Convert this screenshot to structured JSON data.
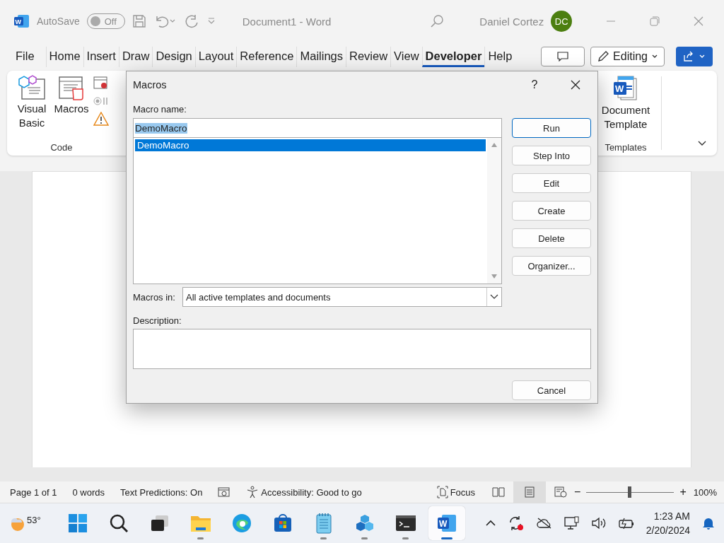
{
  "title_bar": {
    "app_logo": "W",
    "autosave_label": "AutoSave",
    "autosave": {
      "on": false,
      "label": "Off"
    },
    "document_title": "Document1  -  Word",
    "user_name": "Daniel Cortez",
    "user_initials": "DC"
  },
  "tabs": [
    {
      "label": "File",
      "selected": false
    },
    {
      "label": "Home",
      "selected": false
    },
    {
      "label": "Insert",
      "selected": false
    },
    {
      "label": "Draw",
      "selected": false
    },
    {
      "label": "Design",
      "selected": false
    },
    {
      "label": "Layout",
      "selected": false
    },
    {
      "label": "Reference",
      "selected": false
    },
    {
      "label": "Mailings",
      "selected": false
    },
    {
      "label": "Review",
      "selected": false
    },
    {
      "label": "View",
      "selected": false
    },
    {
      "label": "Developer",
      "selected": true
    },
    {
      "label": "Help",
      "selected": false
    }
  ],
  "editing_button": "Editing",
  "ribbon": {
    "code_group": {
      "label": "Code",
      "buttons": [
        "Visual Basic",
        "Macros"
      ]
    },
    "templates_group": {
      "label": "Templates",
      "buttons": [
        "Document Template"
      ],
      "icon_letter": "W"
    }
  },
  "dialog": {
    "title": "Macros",
    "help": "?",
    "macro_name_label": "Macro name:",
    "macro_name": "DemoMacro",
    "macro_name_text_selected": true,
    "macros": [
      {
        "label": "DemoMacro",
        "selected": true
      }
    ],
    "buttons": [
      {
        "label": "Run",
        "default": true
      },
      {
        "label": "Step Into",
        "default": false
      },
      {
        "label": "Edit",
        "default": false
      },
      {
        "label": "Create",
        "default": false
      },
      {
        "label": "Delete",
        "default": false
      },
      {
        "label": "Organizer...",
        "default": false
      }
    ],
    "macros_in_label": "Macros in:",
    "macros_in": "All active templates and documents",
    "description_label": "Description:",
    "cancel": "Cancel"
  },
  "status_bar": {
    "page": "Page 1 of 1",
    "words": "0 words",
    "predictions": "Text Predictions: On",
    "accessibility": "Accessibility: Good to go",
    "focus": "Focus",
    "views": [
      {
        "kind": "read",
        "selected": false
      },
      {
        "kind": "print",
        "selected": true
      },
      {
        "kind": "web",
        "selected": false
      }
    ],
    "zoom": {
      "minus": "−",
      "plus": "+",
      "level": 0.5,
      "label": "100%"
    }
  },
  "taskbar": {
    "weather": "53°",
    "apps": [
      {
        "kind": "start",
        "running": false,
        "selected": false
      },
      {
        "kind": "search",
        "running": false,
        "selected": false
      },
      {
        "kind": "taskview",
        "running": false,
        "selected": false
      },
      {
        "kind": "explorer",
        "running": true,
        "selected": false
      },
      {
        "kind": "edge",
        "running": false,
        "selected": false
      },
      {
        "kind": "store",
        "running": false,
        "selected": false
      },
      {
        "kind": "notepad",
        "running": true,
        "selected": false
      },
      {
        "kind": "cubes",
        "running": true,
        "selected": false
      },
      {
        "kind": "terminal",
        "running": true,
        "selected": false
      },
      {
        "kind": "word",
        "running": true,
        "selected": true,
        "glyph": "W"
      }
    ],
    "time": "1:23 AM",
    "date": "2/20/2024"
  }
}
